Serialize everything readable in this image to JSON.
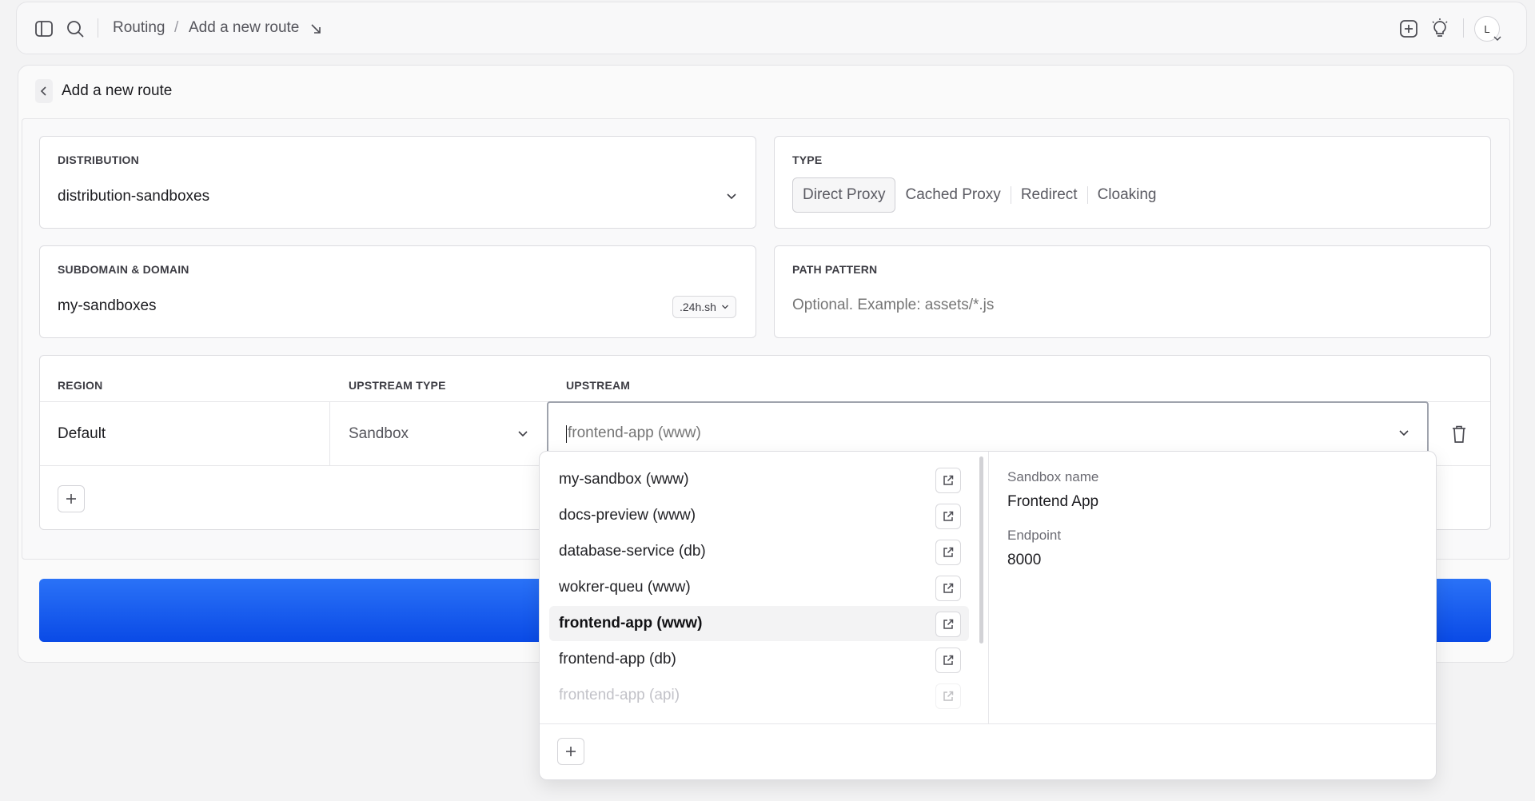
{
  "topbar": {
    "breadcrumb_root": "Routing",
    "breadcrumb_sep": "/",
    "breadcrumb_current": "Add a new route",
    "avatar_initial": "L"
  },
  "page": {
    "title": "Add a new route"
  },
  "distribution": {
    "label": "DISTRIBUTION",
    "value": "distribution-sandboxes"
  },
  "type": {
    "label": "TYPE",
    "options": [
      "Direct Proxy",
      "Cached Proxy",
      "Redirect",
      "Cloaking"
    ],
    "selected": "Direct Proxy"
  },
  "subdomain": {
    "label": "SUBDOMAIN & DOMAIN",
    "value": "my-sandboxes",
    "domain": ".24h.sh"
  },
  "path_pattern": {
    "label": "PATH PATTERN",
    "placeholder": "Optional. Example: assets/*.js"
  },
  "table": {
    "headers": {
      "region": "REGION",
      "upstream_type": "UPSTREAM TYPE",
      "upstream": "UPSTREAM"
    },
    "row": {
      "region": "Default",
      "upstream_type": "Sandbox",
      "upstream_placeholder": "frontend-app (www)"
    }
  },
  "dropdown": {
    "options": [
      "my-sandbox (www)",
      "docs-preview (www)",
      "database-service (db)",
      "wokrer-queu (www)",
      "frontend-app (www)",
      "frontend-app (db)",
      "frontend-app (api)"
    ],
    "selected_index": 4,
    "details": {
      "name_label": "Sandbox name",
      "name_value": "Frontend App",
      "endpoint_label": "Endpoint",
      "endpoint_value": "8000"
    }
  },
  "colors": {
    "accent_blue_top": "#1e6cf6",
    "accent_blue_bottom": "#0046e0"
  }
}
